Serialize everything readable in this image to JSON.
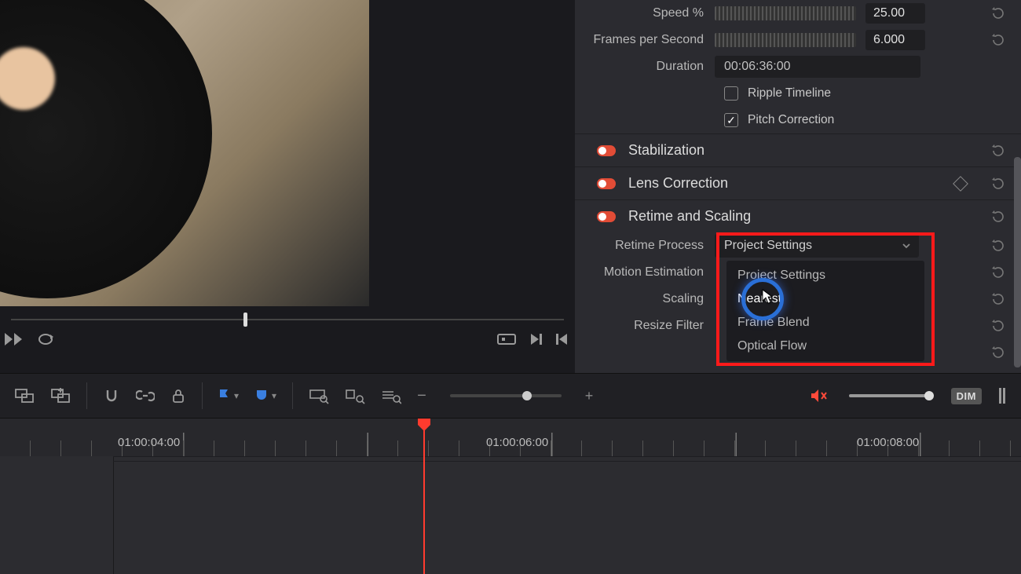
{
  "inspector": {
    "speed": {
      "label": "Speed %",
      "value": "25.00"
    },
    "fps": {
      "label": "Frames per Second",
      "value": "6.000"
    },
    "duration": {
      "label": "Duration",
      "value": "00:06:36:00"
    },
    "ripple": {
      "label": "Ripple Timeline",
      "checked": false
    },
    "pitch": {
      "label": "Pitch Correction",
      "checked": true
    },
    "stabilization": {
      "title": "Stabilization"
    },
    "lens": {
      "title": "Lens Correction"
    },
    "retime": {
      "title": "Retime and Scaling",
      "process_label": "Retime Process",
      "process_value": "Project Settings",
      "options": [
        "Project Settings",
        "Nearest",
        "Frame Blend",
        "Optical Flow"
      ],
      "motion_label": "Motion Estimation",
      "scaling_label": "Scaling",
      "resize_label": "Resize Filter"
    }
  },
  "toolbar": {
    "dim": "DIM"
  },
  "timeline": {
    "labels": [
      "01:00:04:00",
      "01:00:06:00",
      "01:00:08:00"
    ]
  }
}
